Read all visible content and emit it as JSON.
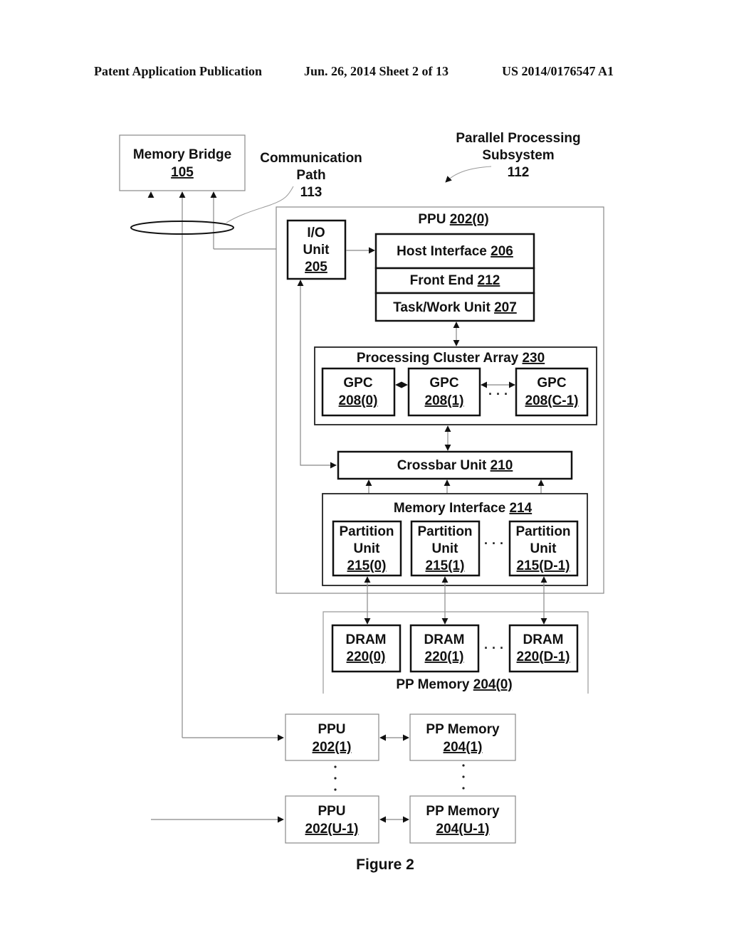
{
  "header": {
    "left": "Patent Application Publication",
    "center": "Jun. 26, 2014  Sheet 2 of 13",
    "right": "US 2014/0176547 A1"
  },
  "labels": {
    "memory_bridge": {
      "name": "Memory Bridge",
      "ref": "105"
    },
    "comm_path": {
      "line1": "Communication",
      "line2": "Path",
      "ref": "113"
    },
    "pps": {
      "line1": "Parallel Processing",
      "line2": "Subsystem",
      "ref": "112"
    },
    "ppu0": {
      "name": "PPU ",
      "ref": "202(0)"
    },
    "io_unit": {
      "line1": "I/O",
      "line2": "Unit",
      "ref": "205"
    },
    "host_interface": {
      "name": "Host Interface ",
      "ref": "206"
    },
    "front_end": {
      "name": "Front End ",
      "ref": "212"
    },
    "task_work": {
      "name": "Task/Work Unit ",
      "ref": "207"
    },
    "pca": {
      "name": "Processing Cluster Array ",
      "ref": "230"
    },
    "gpcs": [
      {
        "name": "GPC",
        "ref": "208(0)"
      },
      {
        "name": "GPC",
        "ref": "208(1)"
      },
      {
        "name": "GPC",
        "ref": "208(C-1)"
      }
    ],
    "crossbar": {
      "name": "Crossbar Unit ",
      "ref": "210"
    },
    "mem_interface": {
      "name": "Memory Interface ",
      "ref": "214"
    },
    "partitions": [
      {
        "line1": "Partition",
        "line2": "Unit",
        "ref": "215(0)"
      },
      {
        "line1": "Partition",
        "line2": "Unit",
        "ref": "215(1)"
      },
      {
        "line1": "Partition",
        "line2": "Unit",
        "ref": "215(D-1)"
      }
    ],
    "drams": [
      {
        "name": "DRAM",
        "ref": "220(0)"
      },
      {
        "name": "DRAM",
        "ref": "220(1)"
      },
      {
        "name": "DRAM",
        "ref": "220(D-1)"
      }
    ],
    "pp_memory0": {
      "name": "PP Memory ",
      "ref": "204(0)"
    },
    "ppu1": {
      "name": "PPU",
      "ref": "202(1)"
    },
    "ppmem1": {
      "name": "PP Memory",
      "ref": "204(1)"
    },
    "ppuU": {
      "name": "PPU",
      "ref": "202(U-1)"
    },
    "ppmemU": {
      "name": "PP Memory",
      "ref": "204(U-1)"
    },
    "ellipsis": "· · ·",
    "vdot": "."
  },
  "caption": "Figure 2"
}
